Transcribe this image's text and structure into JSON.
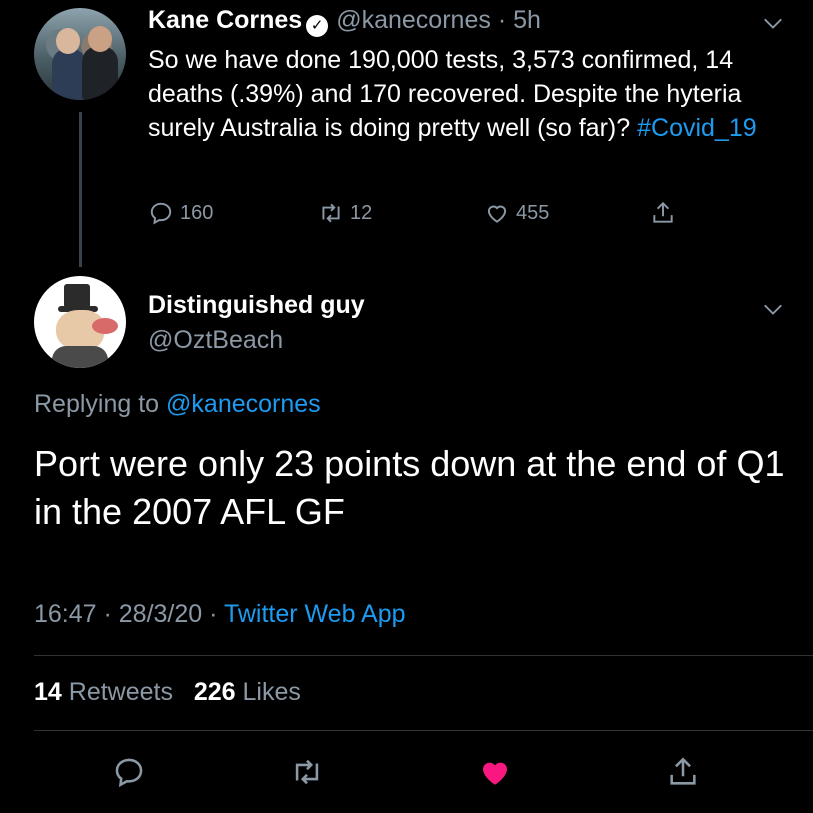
{
  "parent_tweet": {
    "author_name": "Kane Cornes",
    "handle": "@kanecornes",
    "time": "· 5h",
    "text": "So we have done 190,000 tests, 3,573 confirmed, 14 deaths (.39%) and 170 recovered. Despite the hyteria surely Australia is doing pretty well (so far)?",
    "hashtag": "#Covid_19",
    "replies": "160",
    "retweets": "12",
    "likes": "455",
    "verified_icon": "verified-badge-icon"
  },
  "reply_tweet": {
    "author_name": "Distinguished guy",
    "handle": "@OztBeach",
    "replying_prefix": "Replying to",
    "replying_to": "@kanecornes",
    "text": "Port were only 23 points down at the end of Q1 in the 2007 AFL GF",
    "time": "16:47 · 28/3/20 ·",
    "source": "Twitter Web App",
    "retweet_count": "14",
    "retweet_label": "Retweets",
    "like_count": "226",
    "like_label": "Likes"
  },
  "colors": {
    "background": "#000000",
    "link": "#1d9bf0",
    "secondary_text": "#8b98a5",
    "like_active": "#f91880"
  }
}
